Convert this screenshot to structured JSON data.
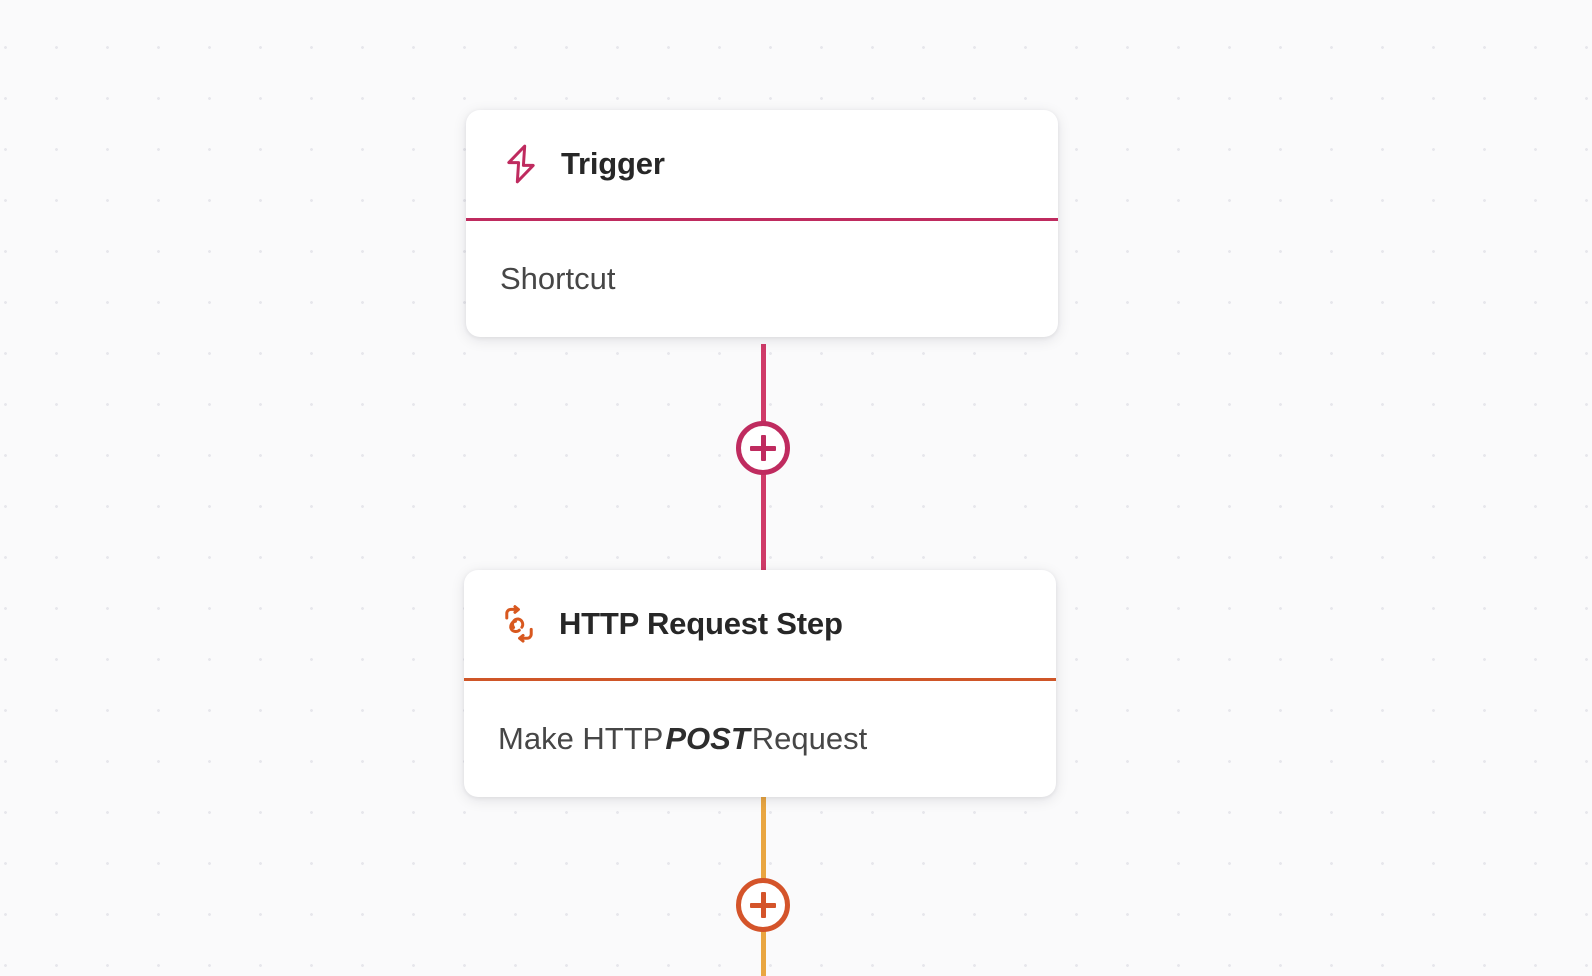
{
  "canvas": {
    "background_color": "#fafafb",
    "grid_dot_color": "#e7e7ec",
    "grid_spacing_px": 51
  },
  "colors": {
    "trigger_accent": "#bf2b5f",
    "trigger_connector": "#cf3a68",
    "http_accent": "#cf5628",
    "http_node_border": "#d4542a",
    "http_connector": "#e9a641",
    "title_text": "#272727",
    "body_text": "#464646"
  },
  "nodes": [
    {
      "id": "trigger",
      "icon": "lightning-bolt-icon",
      "title": "Trigger",
      "body_text": "Shortcut",
      "accent_color": "#bf2b5f"
    },
    {
      "id": "http-request-step",
      "icon": "chain-link-icon",
      "title": "HTTP Request Step",
      "body_prefix": "Make HTTP",
      "body_emphasis": "POST",
      "body_suffix": "Request",
      "accent_color": "#cf5628"
    }
  ],
  "connectors": [
    {
      "id": "trigger-to-http",
      "from": "trigger",
      "to": "http-request-step",
      "color": "#cf3a68",
      "add_button_label": "+"
    },
    {
      "id": "http-downstream",
      "from": "http-request-step",
      "to": "",
      "color": "#e9a641",
      "add_button_label": "+"
    }
  ]
}
